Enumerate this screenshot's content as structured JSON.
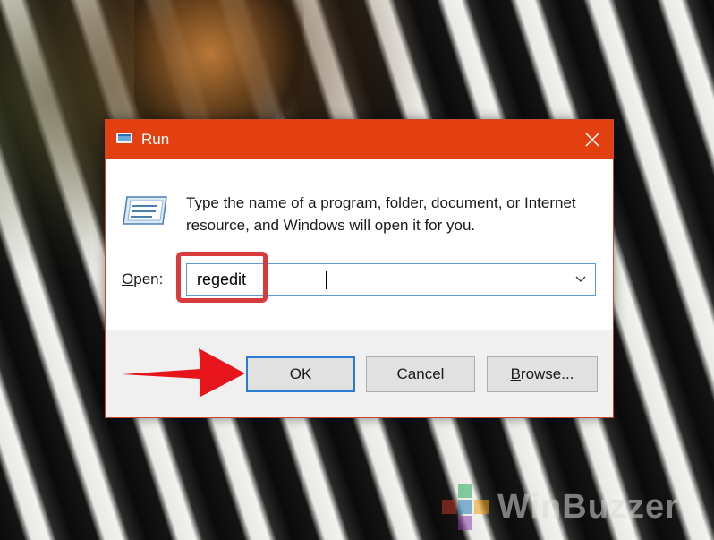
{
  "dialog": {
    "title": "Run",
    "description": "Type the name of a program, folder, document, or Internet resource, and Windows will open it for you.",
    "open_label": "Open:",
    "open_value": "regedit",
    "buttons": {
      "ok": "OK",
      "cancel": "Cancel",
      "browse_underlined": "B",
      "browse_rest": "rowse..."
    }
  },
  "watermark": {
    "text": "WinBuzzer"
  },
  "colors": {
    "title_bar": "#e24010",
    "highlight": "#d83b3b",
    "focus": "#2b7bd4"
  },
  "icons": [
    "run-app-icon",
    "close-icon",
    "chevron-down-icon",
    "run-program-icon"
  ]
}
